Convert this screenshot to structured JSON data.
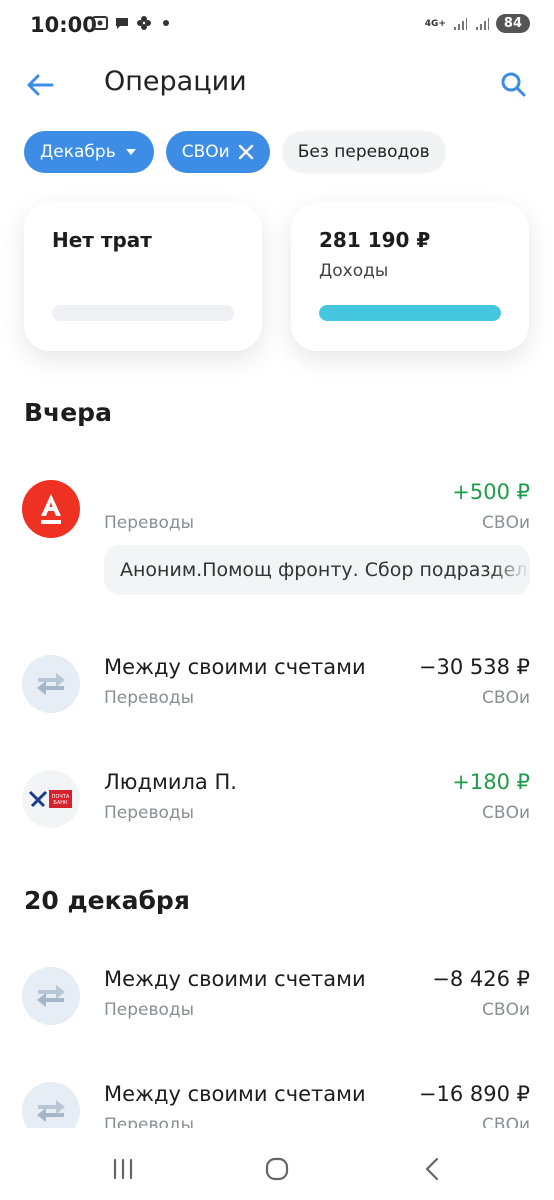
{
  "status_bar": {
    "time": "10:00",
    "network": "4G+",
    "battery": "84"
  },
  "header": {
    "title": "Операции"
  },
  "filters": {
    "month": "Декабрь",
    "account": "СВОи",
    "no_transfers": "Без переводов"
  },
  "summary": {
    "expenses": {
      "title": "Нет трат"
    },
    "income": {
      "amount": "281 190 ₽",
      "label": "Доходы",
      "fill": 1.0
    }
  },
  "sections": [
    {
      "title": "Вчера",
      "items": [
        {
          "name": "",
          "category": "Переводы",
          "amount": "+500 ₽",
          "account": "СВОи",
          "comment": "Аноним.Помощ фронту. Сбор подразделения",
          "icon": "alfa-bank-icon"
        },
        {
          "name": "Между своими счетами",
          "category": "Переводы",
          "amount": "−30 538 ₽",
          "account": "СВОи",
          "icon": "transfer-arrows-icon"
        },
        {
          "name": "Людмила П.",
          "category": "Переводы",
          "amount": "+180 ₽",
          "account": "СВОи",
          "icon": "pochta-bank-icon"
        }
      ]
    },
    {
      "title": "20 декабря",
      "items": [
        {
          "name": "Между своими счетами",
          "category": "Переводы",
          "amount": "−8 426 ₽",
          "account": "СВОи",
          "icon": "transfer-arrows-icon"
        },
        {
          "name": "Между своими счетами",
          "category": "Переводы",
          "amount": "−16 890 ₽",
          "account": "СВОи",
          "icon": "transfer-arrows-icon"
        }
      ]
    }
  ],
  "pochta_logo_text": "ПОЧТА БАНК",
  "colors": {
    "accent": "#3d8ce6",
    "positive": "#1f9c4a",
    "income_bar": "#45c6df",
    "alfa_red": "#ef3124"
  }
}
